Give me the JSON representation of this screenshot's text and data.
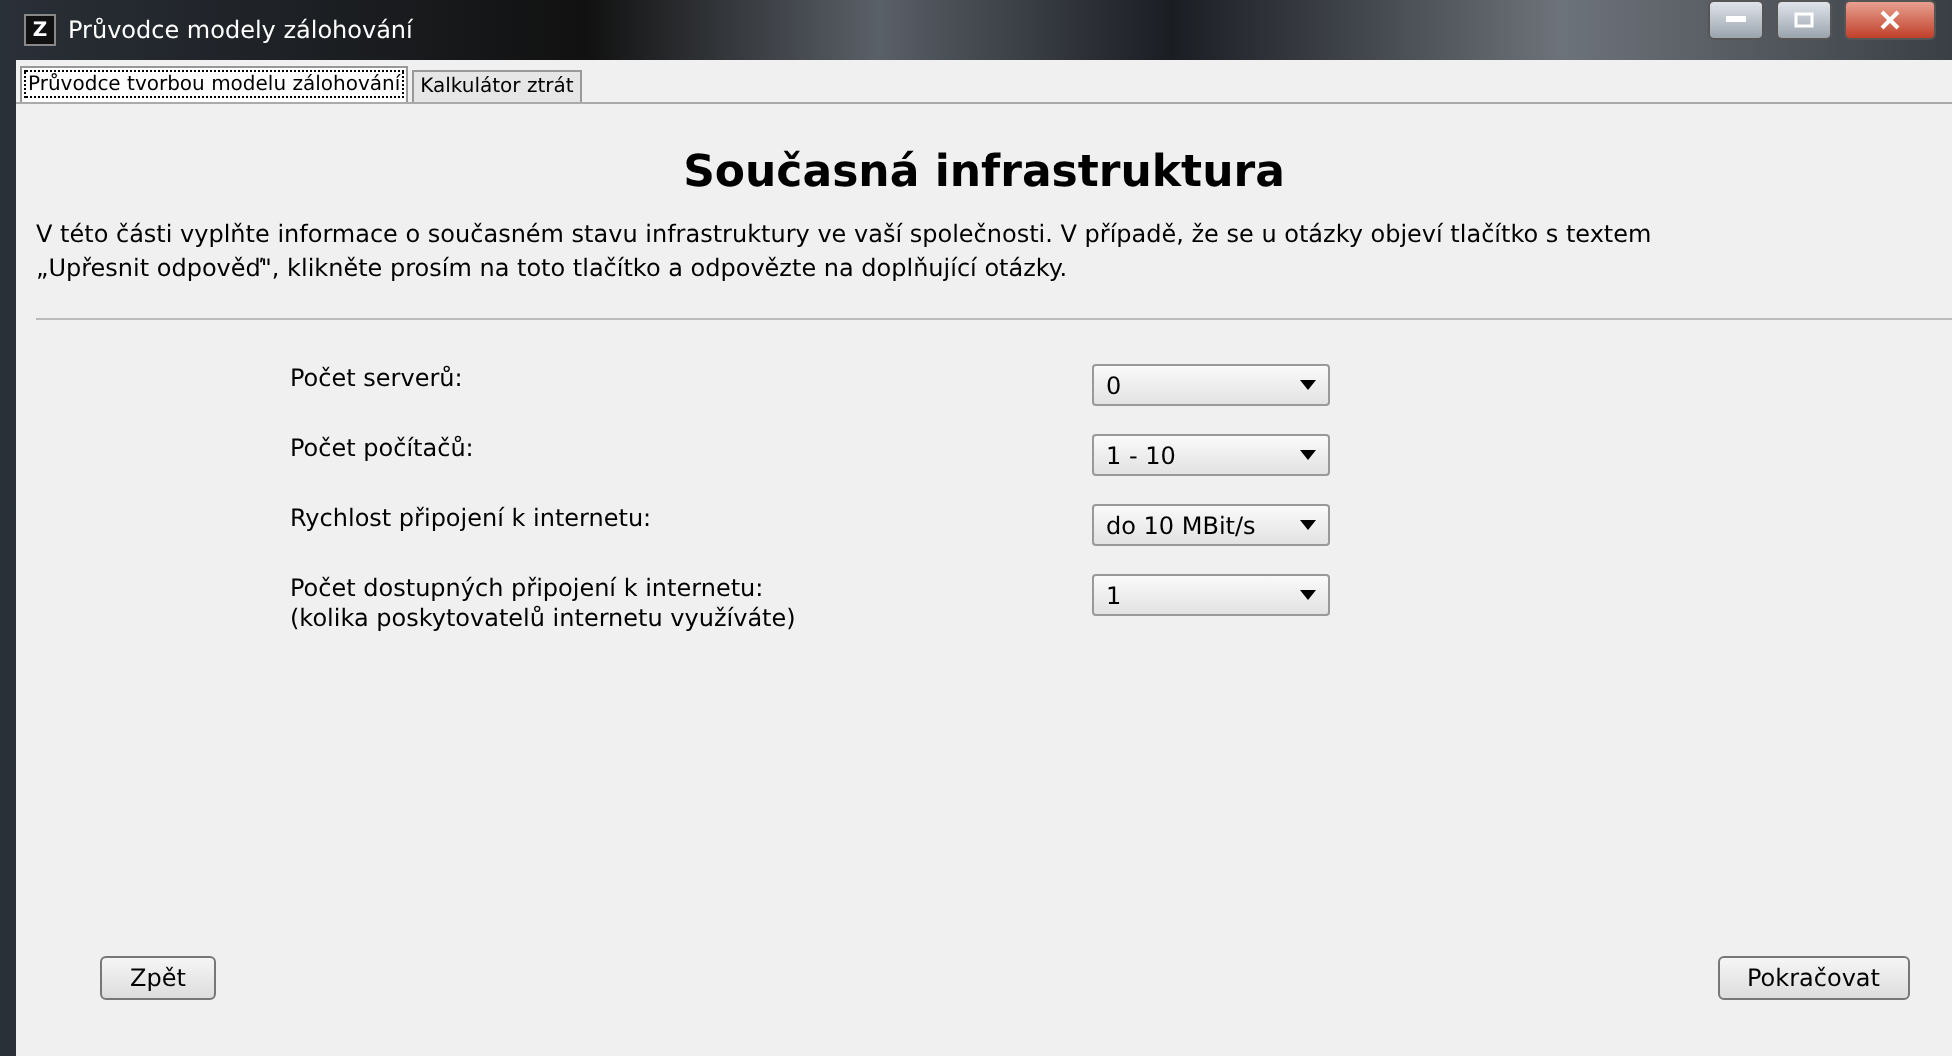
{
  "window": {
    "title": "Průvodce modely zálohování",
    "app_letter": "Z"
  },
  "tabs": [
    {
      "label": "Průvodce tvorbou modelu zálohování",
      "selected": true
    },
    {
      "label": "Kalkulátor ztrát",
      "selected": false
    }
  ],
  "heading": "Současná infrastruktura",
  "intro": [
    "V této části vyplňte informace o současném stavu infrastruktury ve vaší společnosti. V případě, že se u otázky objeví tlačítko s textem",
    " „Upřesnit odpověď\", klikněte prosím na toto tlačítko a odpovězte na doplňující otázky."
  ],
  "questions": [
    {
      "label": "Počet serverů:",
      "value": "0"
    },
    {
      "label": "Počet počítačů:",
      "value": "1 - 10"
    },
    {
      "label": "Rychlost připojení k internetu:",
      "value": "do 10 MBit/s"
    },
    {
      "label": "Počet dostupných připojení k internetu:",
      "note": "(kolika poskytovatelů internetu využíváte)",
      "value": "1"
    }
  ],
  "buttons": {
    "back": "Zpět",
    "next": "Pokračovat"
  }
}
